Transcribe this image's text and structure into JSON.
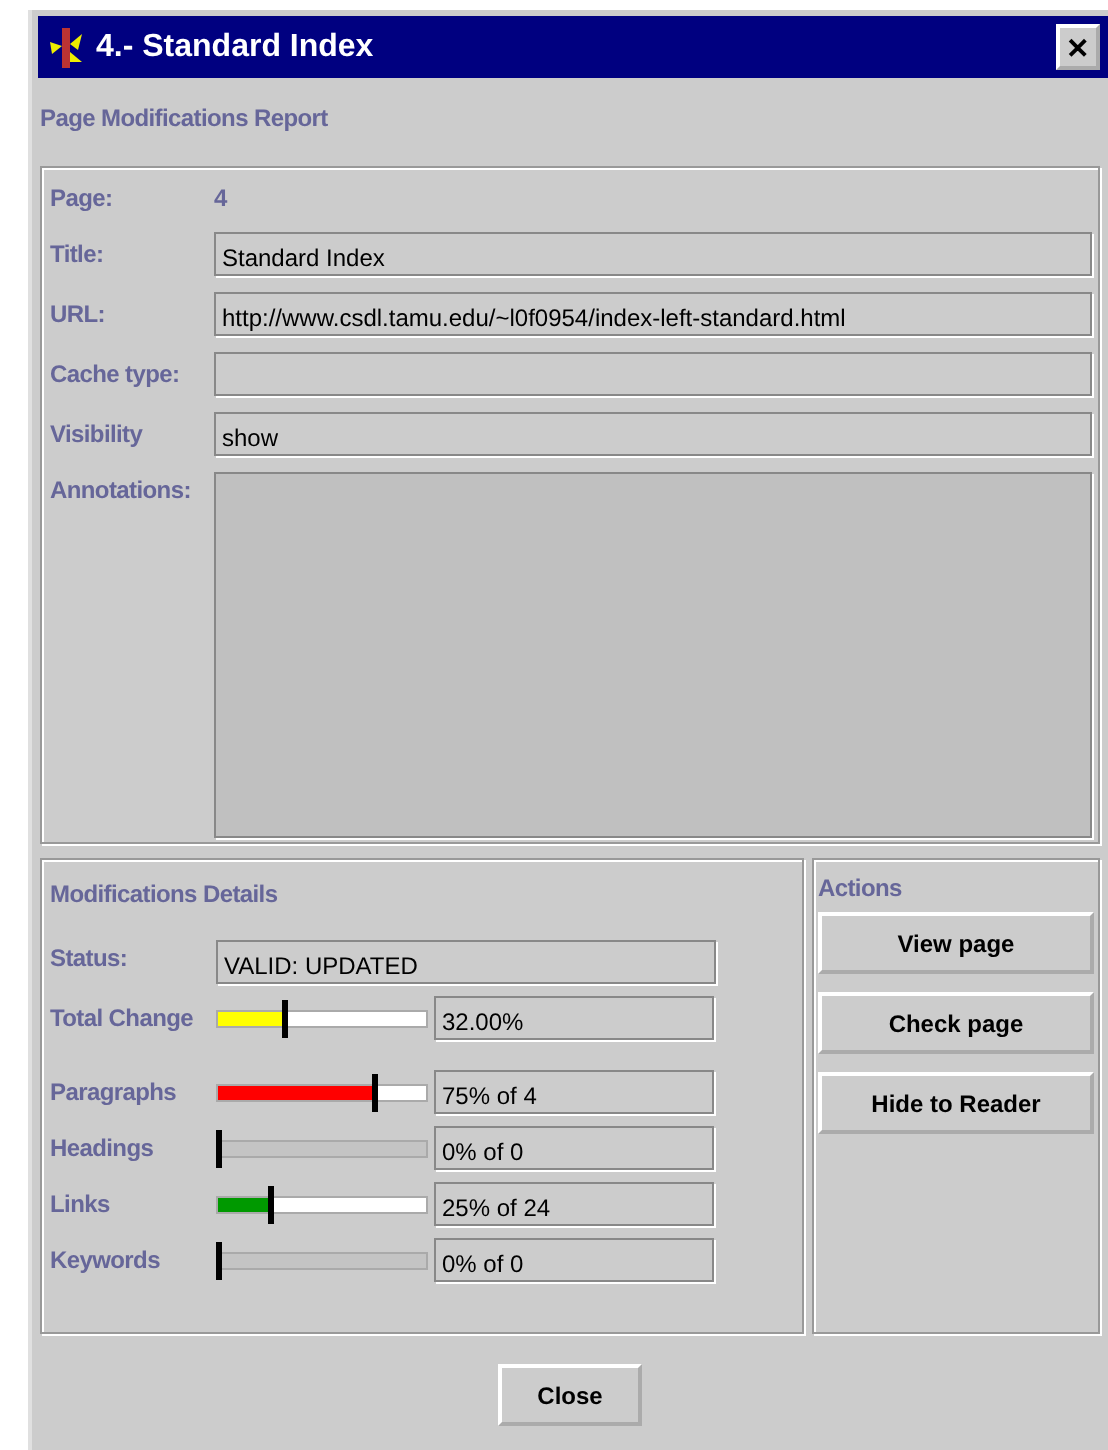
{
  "window": {
    "title": "4.- Standard Index",
    "close": "✕"
  },
  "heading": "Page Modifications Report",
  "fields": [
    {
      "label": "Page:",
      "value": "4",
      "kind": "plain"
    },
    {
      "label": "Title:",
      "value": "Standard Index",
      "kind": "field"
    },
    {
      "label": "URL:",
      "value": "http://www.csdl.tamu.edu/~l0f0954/index-left-standard.html",
      "kind": "field"
    },
    {
      "label": "Cache type:",
      "kind": "field"
    },
    {
      "label": "Visibility",
      "value": "show",
      "kind": "field"
    },
    {
      "label": "Annotations:",
      "kind": "area"
    }
  ],
  "details": {
    "title": "Modifications Details",
    "status_label": "Status:",
    "status": "VALID: UPDATED",
    "meters": [
      {
        "label": "Total Change",
        "level": 0.32,
        "color": "#ffff00",
        "disabled": false,
        "reading": "32.00%"
      },
      {
        "label": "Paragraphs",
        "level": 0.75,
        "color": "#ff0000",
        "disabled": false,
        "reading": "75% of 4"
      },
      {
        "label": "Headings",
        "level": 0,
        "disabled": true,
        "reading": "0% of 0"
      },
      {
        "label": "Links",
        "level": 0.25,
        "color": "#009900",
        "disabled": false,
        "reading": "25% of 24"
      },
      {
        "label": "Keywords",
        "level": 0,
        "disabled": true,
        "reading": "0% of 0"
      }
    ]
  },
  "actions": {
    "title": "Actions",
    "buttons": [
      "View page",
      "Check page",
      "Hide to Reader"
    ]
  },
  "footer_button": "Close"
}
